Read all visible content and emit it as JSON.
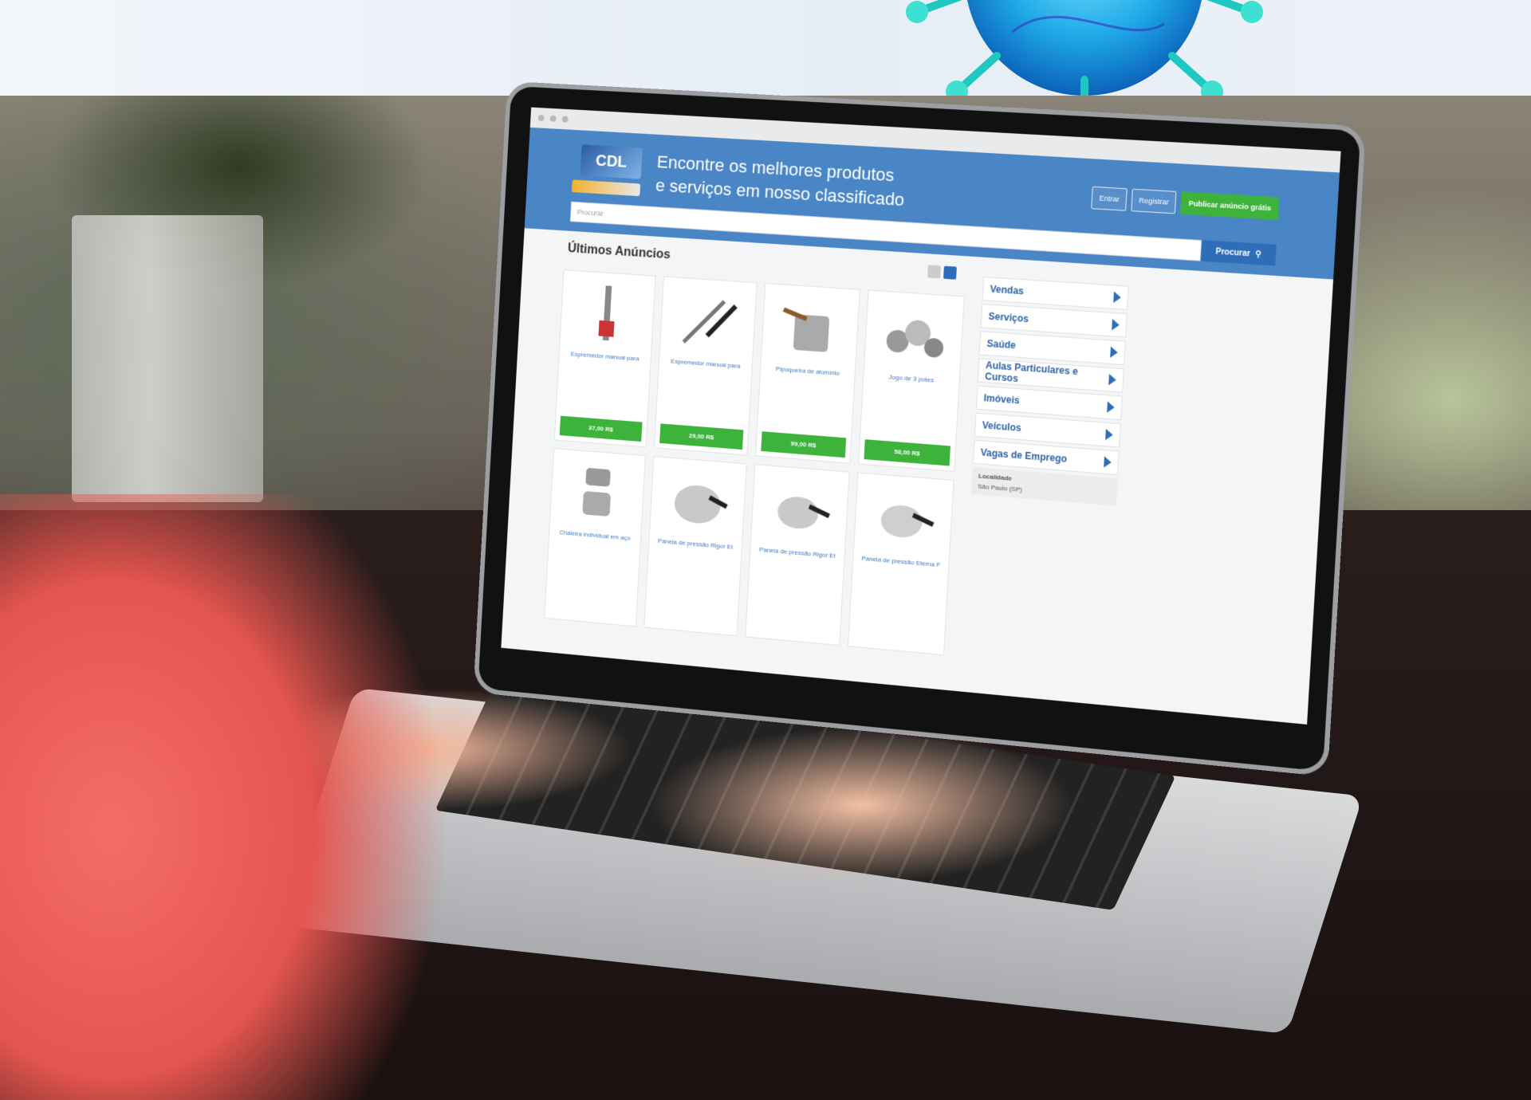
{
  "screen": {
    "site": {
      "logo": "CDL",
      "tagline_line1": "Encontre os melhores produtos",
      "tagline_line2": "e serviços em nosso classificado",
      "buttons": [
        "Entrar",
        "Registrar",
        "Publicar anúncio grátis"
      ]
    },
    "search": {
      "placeholder": "Procurar",
      "button": "Procurar"
    },
    "section_title": "Últimos Anúncios",
    "products": [
      {
        "name": "Espremedor manual para",
        "price": "37,00 R$"
      },
      {
        "name": "Espremedor manual para",
        "price": "29,00 R$"
      },
      {
        "name": "Pipoqueira de alumínio",
        "price": "99,00 R$"
      },
      {
        "name": "Jogo de 3 potes",
        "price": "58,00 R$"
      },
      {
        "name": "Chaleira individual em aço",
        "price": ""
      },
      {
        "name": "Panela de pressão Rigor Et",
        "price": ""
      },
      {
        "name": "Panela de pressão Rigor Et",
        "price": ""
      },
      {
        "name": "Panela de pressão Eterna F",
        "price": ""
      }
    ],
    "categories": [
      "Vendas",
      "Serviços",
      "Saúde",
      "Aulas Particulares e Cursos",
      "Imóveis",
      "Veículos",
      "Vagas de Emprego"
    ],
    "location_label": "Localidade",
    "location_value": "São Paulo (SP)"
  },
  "colors": {
    "header": "#4a86c6",
    "accent_green": "#3db33b",
    "link_blue": "#2d63a8",
    "shirt": "#f56d68"
  }
}
